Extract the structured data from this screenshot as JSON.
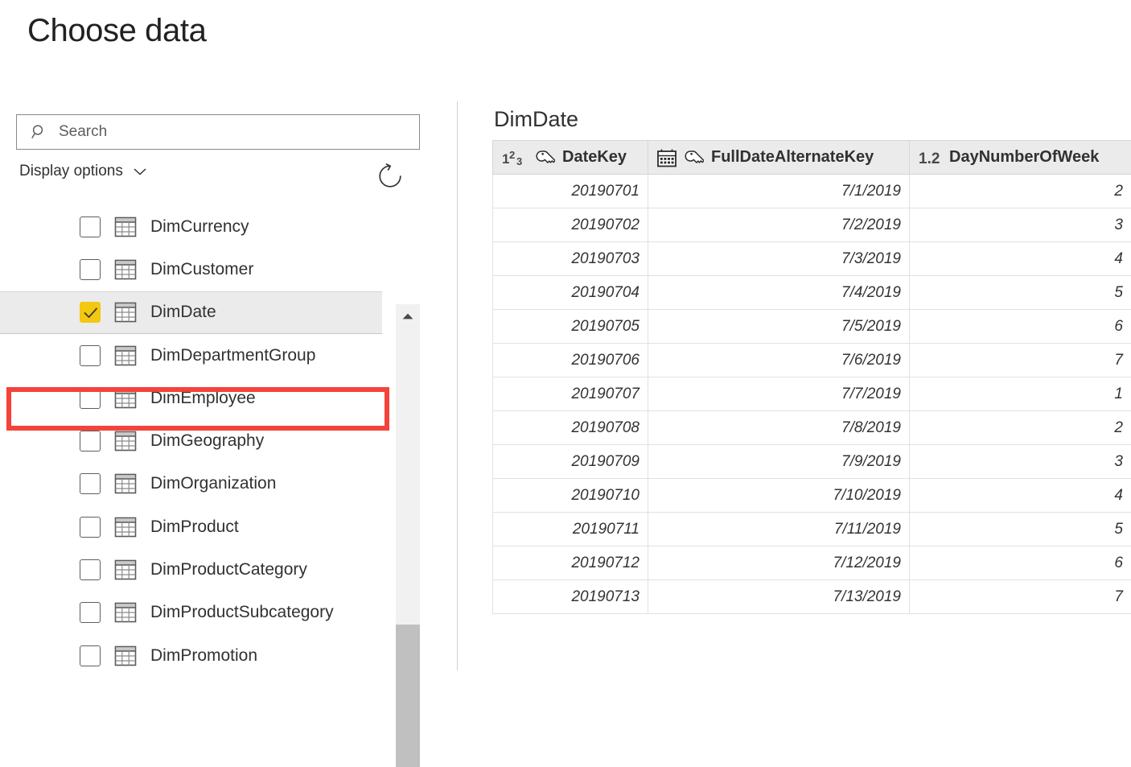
{
  "page_title": "Choose data",
  "search": {
    "placeholder": "Search",
    "value": "",
    "icon": "search-icon"
  },
  "display_options": {
    "label": "Display options",
    "chevron_icon": "chevron-down-icon"
  },
  "refresh": {
    "icon": "refresh-icon",
    "tooltip": "Refresh"
  },
  "colors": {
    "checkbox_checked": "#F2C811",
    "highlight_annotation": "#F4433A",
    "selected_row": "#EBEBEB",
    "header_background": "#EBEBEB"
  },
  "table_list": {
    "items": [
      {
        "label": "DimCurrency",
        "checked": false,
        "icon": "table-icon"
      },
      {
        "label": "DimCustomer",
        "checked": false,
        "icon": "table-icon"
      },
      {
        "label": "DimDate",
        "checked": true,
        "icon": "table-icon"
      },
      {
        "label": "DimDepartmentGroup",
        "checked": false,
        "icon": "table-icon"
      },
      {
        "label": "DimEmployee",
        "checked": false,
        "icon": "table-icon"
      },
      {
        "label": "DimGeography",
        "checked": false,
        "icon": "table-icon"
      },
      {
        "label": "DimOrganization",
        "checked": false,
        "icon": "table-icon"
      },
      {
        "label": "DimProduct",
        "checked": false,
        "icon": "table-icon"
      },
      {
        "label": "DimProductCategory",
        "checked": false,
        "icon": "table-icon"
      },
      {
        "label": "DimProductSubcategory",
        "checked": false,
        "icon": "table-icon"
      },
      {
        "label": "DimPromotion",
        "checked": false,
        "icon": "table-icon"
      }
    ],
    "scrollbar": {
      "up_arrow_icon": "scroll-up-icon"
    }
  },
  "preview": {
    "title": "DimDate",
    "columns": [
      {
        "name": "DateKey",
        "type_icon": "whole-number-icon",
        "type_label": "123",
        "key_icon": "key-icon"
      },
      {
        "name": "FullDateAlternateKey",
        "type_icon": "calendar-icon",
        "type_label": "",
        "key_icon": "key-icon"
      },
      {
        "name": "DayNumberOfWeek",
        "type_icon": "decimal-number-icon",
        "type_label": "1.2",
        "key_icon": ""
      }
    ],
    "rows": [
      [
        "20190701",
        "7/1/2019",
        "2"
      ],
      [
        "20190702",
        "7/2/2019",
        "3"
      ],
      [
        "20190703",
        "7/3/2019",
        "4"
      ],
      [
        "20190704",
        "7/4/2019",
        "5"
      ],
      [
        "20190705",
        "7/5/2019",
        "6"
      ],
      [
        "20190706",
        "7/6/2019",
        "7"
      ],
      [
        "20190707",
        "7/7/2019",
        "1"
      ],
      [
        "20190708",
        "7/8/2019",
        "2"
      ],
      [
        "20190709",
        "7/9/2019",
        "3"
      ],
      [
        "20190710",
        "7/10/2019",
        "4"
      ],
      [
        "20190711",
        "7/11/2019",
        "5"
      ],
      [
        "20190712",
        "7/12/2019",
        "6"
      ],
      [
        "20190713",
        "7/13/2019",
        "7"
      ]
    ]
  }
}
